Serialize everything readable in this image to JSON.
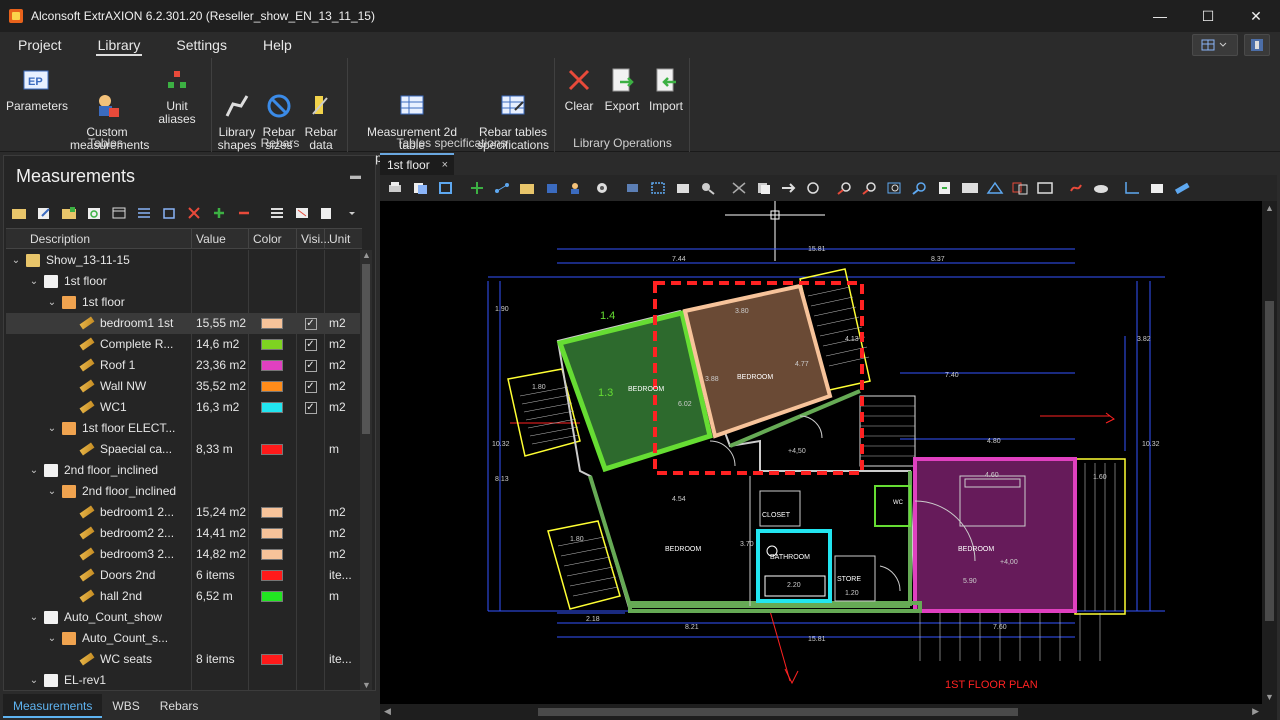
{
  "window": {
    "title": "Alconsoft ExtrAXION 6.2.301.20 (Reseller_show_EN_13_11_15)",
    "controls": {
      "minimize": "—",
      "maximize": "☐",
      "close": "✕"
    }
  },
  "menu": [
    {
      "label": "Project"
    },
    {
      "label": "Library"
    },
    {
      "label": "Settings"
    },
    {
      "label": "Help"
    }
  ],
  "ribbon": {
    "groups": [
      {
        "label": "Tables",
        "buttons": [
          {
            "label": "Parameters",
            "icon": "parameters-icon"
          },
          {
            "label": "Custom\nmeasurements",
            "icon": "custom-measurements-icon"
          },
          {
            "label": "Unit aliases",
            "icon": "unit-aliases-icon"
          }
        ]
      },
      {
        "label": "Rebars",
        "buttons": [
          {
            "label": "Library\nshapes",
            "icon": "library-shapes-icon"
          },
          {
            "label": "Rebar\nsizes",
            "icon": "rebar-sizes-icon"
          },
          {
            "label": "Rebar\ndata",
            "icon": "rebar-data-icon"
          }
        ]
      },
      {
        "label": "Tables specifications",
        "buttons": [
          {
            "label": "Measurement 2d table\nspecifications ⌄",
            "icon": "measurement-table-icon"
          },
          {
            "label": "Rebar tables\nspecifications ⌄",
            "icon": "rebar-table-icon"
          }
        ]
      },
      {
        "label": "Library Operations",
        "buttons": [
          {
            "label": "Clear",
            "icon": "clear-icon"
          },
          {
            "label": "Export",
            "icon": "export-icon"
          },
          {
            "label": "Import",
            "icon": "import-icon"
          }
        ]
      }
    ]
  },
  "panel": {
    "title": "Measurements",
    "pin": "📌",
    "columns": [
      "Description",
      "Value",
      "Color",
      "Visi...",
      "Unit"
    ],
    "rows": [
      {
        "level": 0,
        "type": "folder",
        "label": "Show_13-11-15",
        "value": "",
        "color": "",
        "vis": false,
        "unit": "",
        "expanded": true
      },
      {
        "level": 1,
        "type": "doc",
        "label": "1st floor",
        "value": "",
        "color": "",
        "vis": false,
        "unit": "",
        "expanded": true
      },
      {
        "level": 2,
        "type": "page",
        "label": "1st floor",
        "value": "",
        "color": "",
        "vis": false,
        "unit": "",
        "expanded": true
      },
      {
        "level": 3,
        "type": "ruler",
        "label": "bedroom1 1st",
        "value": "15,55 m2",
        "color": "#f7c39a",
        "vis": true,
        "unit": "m2",
        "selected": true
      },
      {
        "level": 3,
        "type": "ruler",
        "label": "Complete R...",
        "value": "14,6 m2",
        "color": "#7ed321",
        "vis": true,
        "unit": "m2"
      },
      {
        "level": 3,
        "type": "ruler",
        "label": "Roof 1",
        "value": "23,36 m2",
        "color": "#e040c0",
        "vis": true,
        "unit": "m2"
      },
      {
        "level": 3,
        "type": "ruler",
        "label": "Wall NW",
        "value": "35,52 m2",
        "color": "#ff8c1a",
        "vis": true,
        "unit": "m2"
      },
      {
        "level": 3,
        "type": "ruler",
        "label": "WC1",
        "value": "16,3 m2",
        "color": "#22e5f0",
        "vis": true,
        "unit": "m2"
      },
      {
        "level": 2,
        "type": "page",
        "label": "1st floor ELECT...",
        "value": "",
        "color": "",
        "vis": false,
        "unit": "",
        "expanded": true
      },
      {
        "level": 3,
        "type": "ruler",
        "label": "Spaecial ca...",
        "value": "8,33 m",
        "color": "#ff1a1a",
        "vis": false,
        "unit": "m"
      },
      {
        "level": 1,
        "type": "doc",
        "label": "2nd floor_inclined",
        "value": "",
        "color": "",
        "vis": false,
        "unit": "",
        "expanded": true
      },
      {
        "level": 2,
        "type": "page",
        "label": "2nd floor_inclined",
        "value": "",
        "color": "",
        "vis": false,
        "unit": "",
        "expanded": true
      },
      {
        "level": 3,
        "type": "ruler",
        "label": "bedroom1 2...",
        "value": "15,24 m2",
        "color": "#f7c39a",
        "vis": false,
        "unit": "m2"
      },
      {
        "level": 3,
        "type": "ruler",
        "label": "bedroom2 2...",
        "value": "14,41 m2",
        "color": "#f7c39a",
        "vis": false,
        "unit": "m2"
      },
      {
        "level": 3,
        "type": "ruler",
        "label": "bedroom3 2...",
        "value": "14,82 m2",
        "color": "#f7c39a",
        "vis": false,
        "unit": "m2"
      },
      {
        "level": 3,
        "type": "ruler",
        "label": "Doors 2nd",
        "value": "6 items",
        "color": "#ff1a1a",
        "vis": false,
        "unit": "ite..."
      },
      {
        "level": 3,
        "type": "ruler",
        "label": "hall 2nd",
        "value": "6,52 m",
        "color": "#22e522",
        "vis": false,
        "unit": "m"
      },
      {
        "level": 1,
        "type": "doc",
        "label": "Auto_Count_show",
        "value": "",
        "color": "",
        "vis": false,
        "unit": "",
        "expanded": true
      },
      {
        "level": 2,
        "type": "page",
        "label": "Auto_Count_s...",
        "value": "",
        "color": "",
        "vis": false,
        "unit": "",
        "expanded": true
      },
      {
        "level": 3,
        "type": "ruler",
        "label": "WC seats",
        "value": "8 items",
        "color": "#ff1a1a",
        "vis": false,
        "unit": "ite..."
      },
      {
        "level": 1,
        "type": "doc",
        "label": "EL-rev1",
        "value": "",
        "color": "",
        "vis": false,
        "unit": "",
        "expanded": true
      }
    ]
  },
  "bottom_tabs": [
    "Measurements",
    "WBS",
    "Rebars"
  ],
  "doc_tab": {
    "label": "1st floor",
    "close": "×"
  },
  "plan": {
    "title": "1ST FLOOR PLAN",
    "rooms": [
      "BEDROOM",
      "BEDROOM",
      "BEDROOM",
      "BEDROOM",
      "BATHROOM",
      "CLOSET",
      "STORE",
      "WC"
    ],
    "dims": [
      "15.81",
      "7.44",
      "8.37",
      "7.40",
      "4.80",
      "4.54",
      "8.21",
      "15.81",
      "2.18",
      "7.60",
      "3.80",
      "3.82",
      "10.32",
      "10.32",
      "1.60",
      "5.90",
      "4.60",
      "2.20",
      "1.20",
      "3.70",
      "1.90",
      "8.13",
      "4.77",
      "3.88",
      "6.02",
      "4.13",
      "1.4",
      "1.3",
      "+4,50",
      "+4,00",
      "1.80",
      "1.80"
    ]
  }
}
